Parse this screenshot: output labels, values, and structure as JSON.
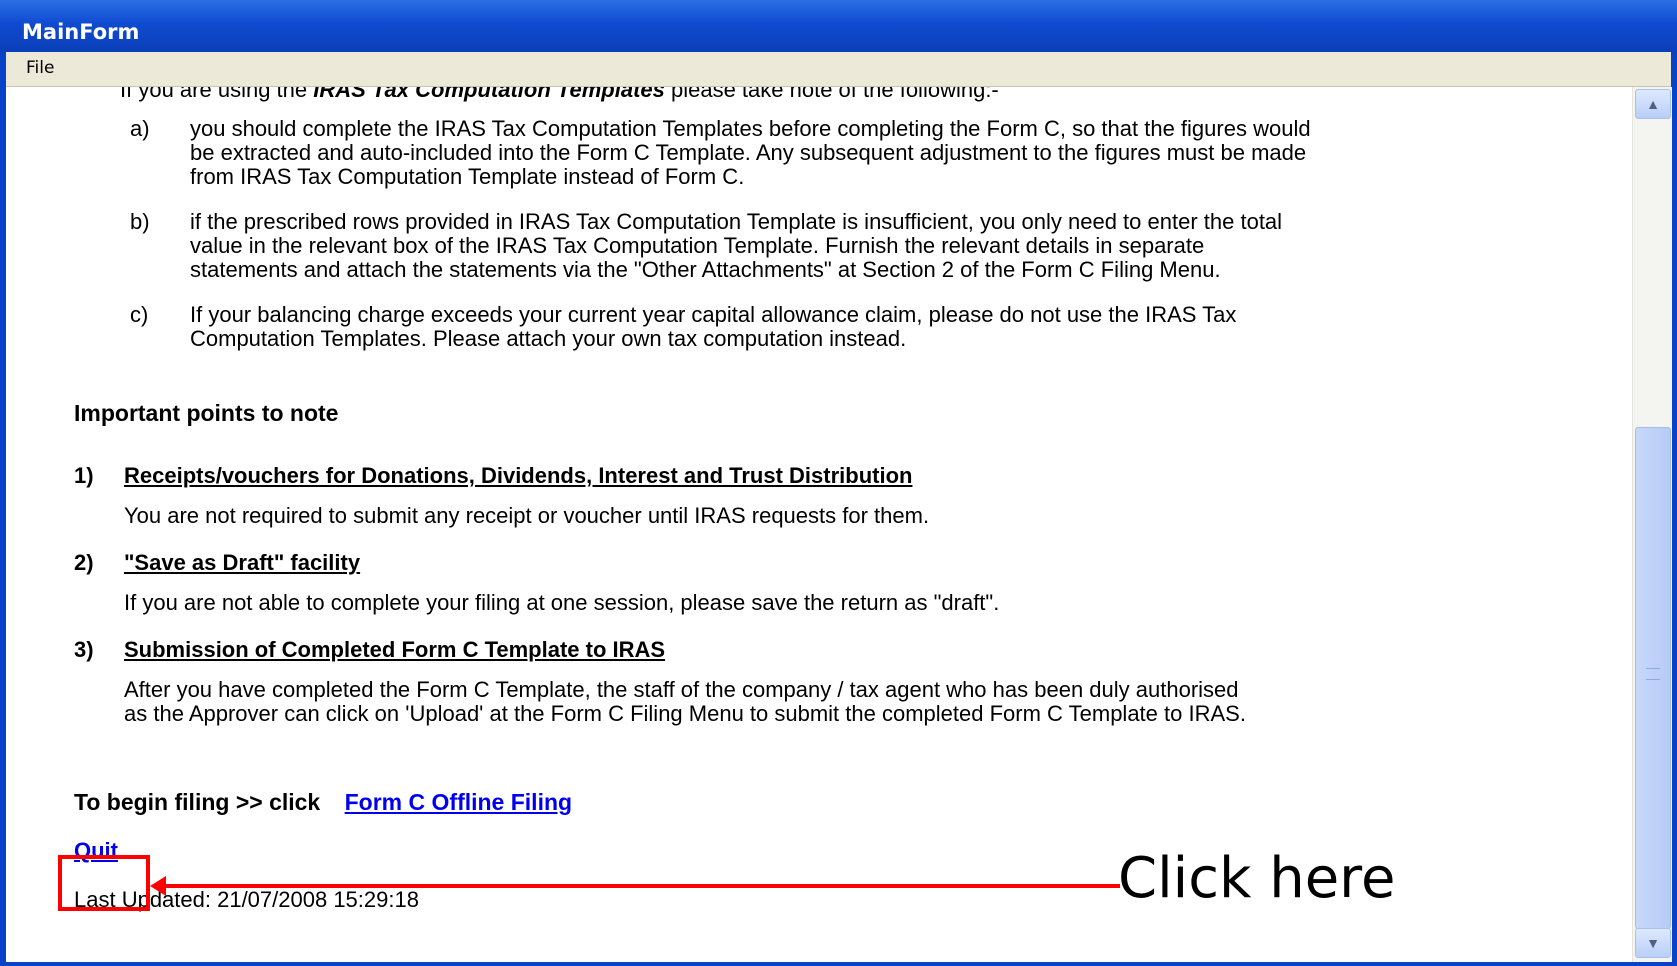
{
  "window": {
    "title": "MainForm"
  },
  "menu": {
    "file": "File"
  },
  "intro": {
    "pre": "If you are using the ",
    "emph": "IRAS Tax Computation Templates",
    "post": " please take note of the following:-"
  },
  "notes": [
    {
      "marker": "a)",
      "lines": [
        "you should complete the IRAS Tax Computation Templates before completing the Form C, so that the figures would",
        "be extracted and auto-included into the Form C Template. Any subsequent adjustment to the figures must be made",
        "from IRAS Tax Computation Template instead of Form C."
      ]
    },
    {
      "marker": "b)",
      "lines": [
        "if the prescribed rows provided in IRAS Tax Computation Template is insufficient, you only need to enter the total",
        "value in the relevant box of the IRAS Tax Computation Template. Furnish the relevant details in separate",
        "statements and attach the statements via the \"Other Attachments\" at Section 2 of the Form C Filing Menu."
      ]
    },
    {
      "marker": "c)",
      "lines": [
        "If your balancing charge exceeds your current year capital allowance claim, please do not use the IRAS Tax",
        "Computation Templates. Please attach your own tax computation instead."
      ]
    }
  ],
  "important": {
    "heading": "Important points to note",
    "points": [
      {
        "num": "1)",
        "title": "Receipts/vouchers for Donations, Dividends, Interest and Trust Distribution",
        "lines": [
          "You are not required to submit any receipt or voucher until IRAS requests for them."
        ]
      },
      {
        "num": "2)",
        "title": "\"Save as Draft\" facility",
        "lines": [
          "If you are not able to complete your filing at one session, please save the return as \"draft\"."
        ]
      },
      {
        "num": "3)",
        "title": "Submission of Completed Form C Template to IRAS",
        "lines": [
          "After you have completed the Form C Template, the staff of the company / tax agent who has been duly authorised",
          "as the Approver can click on 'Upload' at the Form C Filing Menu to submit the completed Form C Template to IRAS."
        ]
      }
    ]
  },
  "begin": {
    "prefix": "To begin filing >> click",
    "link": "Form C Offline Filing"
  },
  "quit": "Quit",
  "last_updated": "Last Updated: 21/07/2008 15:29:18",
  "annotation": "Click here",
  "colors": {
    "title_bar": "#0a3fb9",
    "link": "#0000ee",
    "annotation": "#ff0000"
  }
}
